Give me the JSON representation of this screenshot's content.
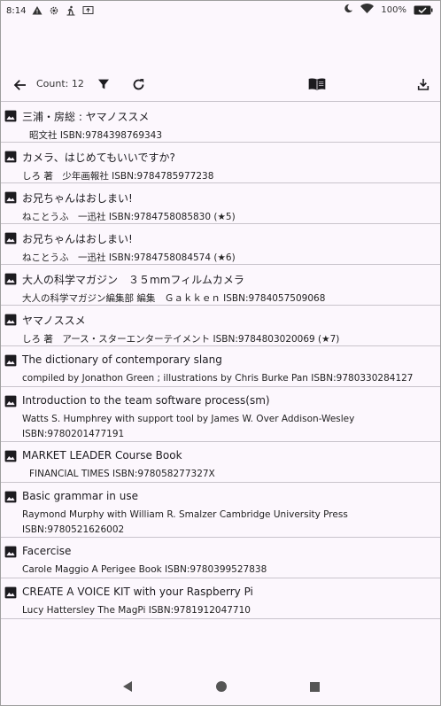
{
  "status": {
    "time": "8:14",
    "battery": "100%"
  },
  "toolbar": {
    "count_label": "Count: 12"
  },
  "books": [
    {
      "title": "三浦・房総 : ヤマノススメ",
      "lines": [
        "昭文社 ISBN:9784398769343"
      ]
    },
    {
      "title": "カメラ、はじめてもいいですか?",
      "lines": [
        "しろ 著　少年画報社 ISBN:9784785977238"
      ]
    },
    {
      "title": "お兄ちゃんはおしまい!",
      "lines": [
        "ねことうふ　一迅社 ISBN:9784758085830 (★5)"
      ]
    },
    {
      "title": "お兄ちゃんはおしまい!",
      "lines": [
        "ねことうふ　一迅社 ISBN:9784758084574 (★6)"
      ]
    },
    {
      "title": "大人の科学マガジン　３５mmフィルムカメラ",
      "lines": [
        "大人の科学マガジン編集部 編集　Ｇａｋｋｅｎ ISBN:9784057509068"
      ]
    },
    {
      "title": "ヤマノススメ",
      "lines": [
        "しろ 著　アース・スターエンターテイメント ISBN:9784803020069 (★7)"
      ]
    },
    {
      "title": "The dictionary of contemporary slang",
      "lines": [
        "compiled by Jonathon Green ; illustrations by Chris Burke   Pan ISBN:9780330284127"
      ]
    },
    {
      "title": "Introduction to the team software process(sm)",
      "lines": [
        "Watts S. Humphrey with support tool by James W. Over   Addison-Wesley",
        "ISBN:9780201477191"
      ]
    },
    {
      "title": "MARKET LEADER Course Book",
      "lines": [
        "FINANCIAL TIMES ISBN:978058277327X"
      ]
    },
    {
      "title": "Basic grammar in use",
      "lines": [
        "Raymond Murphy with William R. Smalzer   Cambridge University Press",
        "ISBN:9780521626002"
      ]
    },
    {
      "title": "Facercise",
      "lines": [
        "Carole Maggio   A  Perigee Book ISBN:9780399527838"
      ]
    },
    {
      "title": "CREATE A VOICE KIT with your Raspberry Pi",
      "lines": [
        "Lucy Hattersley   The MagPi ISBN:9781912047710"
      ]
    }
  ]
}
